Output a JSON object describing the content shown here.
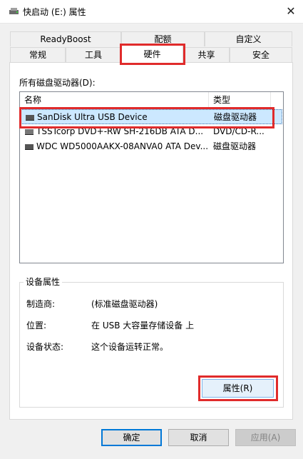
{
  "window": {
    "title": "快启动 (E:) 属性",
    "close_glyph": "✕"
  },
  "tabs": {
    "row1": [
      "ReadyBoost",
      "配额",
      "自定义"
    ],
    "row2": [
      "常规",
      "工具",
      "硬件",
      "共享",
      "安全"
    ],
    "active": "硬件"
  },
  "hardware": {
    "list_label": "所有磁盘驱动器(D):",
    "columns": [
      "名称",
      "类型"
    ],
    "rows": [
      {
        "name": "SanDisk Ultra USB Device",
        "type": "磁盘驱动器",
        "icon": "usb-drive-icon",
        "selected": true
      },
      {
        "name": "TSSTcorp DVD+-RW SH-216DB ATA D...",
        "type": "DVD/CD-R...",
        "icon": "optical-drive-icon",
        "selected": false
      },
      {
        "name": "WDC WD5000AAKX-08ANVA0 ATA Dev...",
        "type": "磁盘驱动器",
        "icon": "hard-drive-icon",
        "selected": false
      }
    ]
  },
  "device_props": {
    "group_title": "设备属性",
    "manufacturer_label": "制造商:",
    "manufacturer_value": "(标准磁盘驱动器)",
    "location_label": "位置:",
    "location_value": "在 USB 大容量存储设备 上",
    "status_label": "设备状态:",
    "status_value": "这个设备运转正常。",
    "properties_button": "属性(R)"
  },
  "footer": {
    "ok": "确定",
    "cancel": "取消",
    "apply": "应用(A)"
  },
  "colors": {
    "annotation_red": "#e02b2b",
    "selection_blue": "#cce8ff",
    "primary_border": "#0078d7"
  }
}
